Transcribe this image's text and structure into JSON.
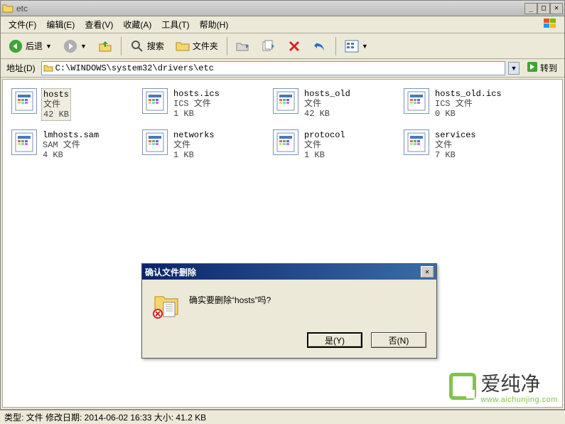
{
  "window": {
    "title": "etc"
  },
  "menu": {
    "file": "文件(F)",
    "edit": "编辑(E)",
    "view": "查看(V)",
    "favorites": "收藏(A)",
    "tools": "工具(T)",
    "help": "帮助(H)"
  },
  "toolbar": {
    "back": "后退",
    "search": "搜索",
    "folders": "文件夹"
  },
  "address": {
    "label": "地址(D)",
    "path": "C:\\WINDOWS\\system32\\drivers\\etc",
    "go": "转到"
  },
  "files": [
    {
      "name": "hosts",
      "type": "文件",
      "size": "42 KB",
      "selected": true
    },
    {
      "name": "hosts.ics",
      "type": "ICS 文件",
      "size": "1 KB"
    },
    {
      "name": "hosts_old",
      "type": "文件",
      "size": "42 KB"
    },
    {
      "name": "hosts_old.ics",
      "type": "ICS 文件",
      "size": "0 KB"
    },
    {
      "name": "lmhosts.sam",
      "type": "SAM 文件",
      "size": "4 KB"
    },
    {
      "name": "networks",
      "type": "文件",
      "size": "1 KB"
    },
    {
      "name": "protocol",
      "type": "文件",
      "size": "1 KB"
    },
    {
      "name": "services",
      "type": "文件",
      "size": "7 KB"
    }
  ],
  "dialog": {
    "title": "确认文件删除",
    "message": "确实要删除“hosts”吗?",
    "yes": "是(Y)",
    "no": "否(N)"
  },
  "statusbar": "类型: 文件 修改日期: 2014-06-02 16:33 大小: 41.2 KB",
  "watermark": {
    "name": "爱纯净",
    "url": "www.aichunjing.com"
  }
}
